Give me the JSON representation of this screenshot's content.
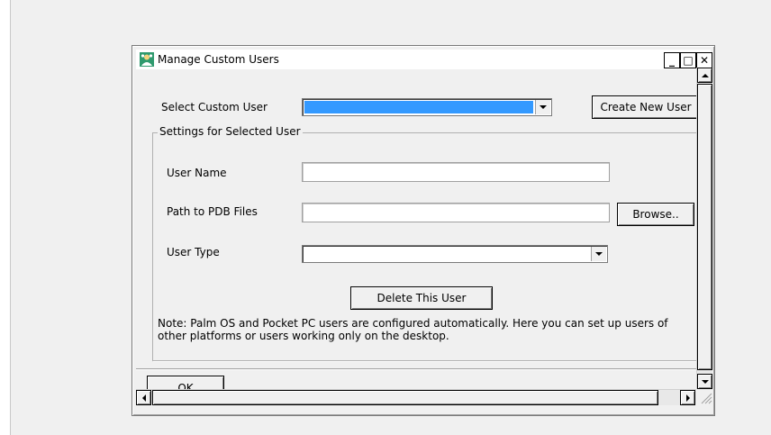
{
  "window": {
    "title": "Manage Custom Users",
    "icon": "palm-desktop-user-icon",
    "minimize_label": "_",
    "maximize_label": "□",
    "close_label": "✕"
  },
  "form": {
    "select_user_label": "Select Custom User",
    "select_user_value": "",
    "create_button_label": "Create New User",
    "group_title": "Settings for Selected User",
    "user_name_label": "User Name",
    "user_name_value": "",
    "path_label": "Path to PDB Files",
    "path_value": "",
    "browse_button_label": "Browse..",
    "user_type_label": "User Type",
    "user_type_value": "",
    "delete_button_label": "Delete This User",
    "note": "Note: Palm OS and Pocket PC users are configured automatically.  Here you can set up  users of other platforms or users working only on the desktop."
  },
  "footer": {
    "ok_button_label": "OK"
  },
  "colors": {
    "selection": "#3399ff",
    "window_bg": "#f0f0f0"
  }
}
